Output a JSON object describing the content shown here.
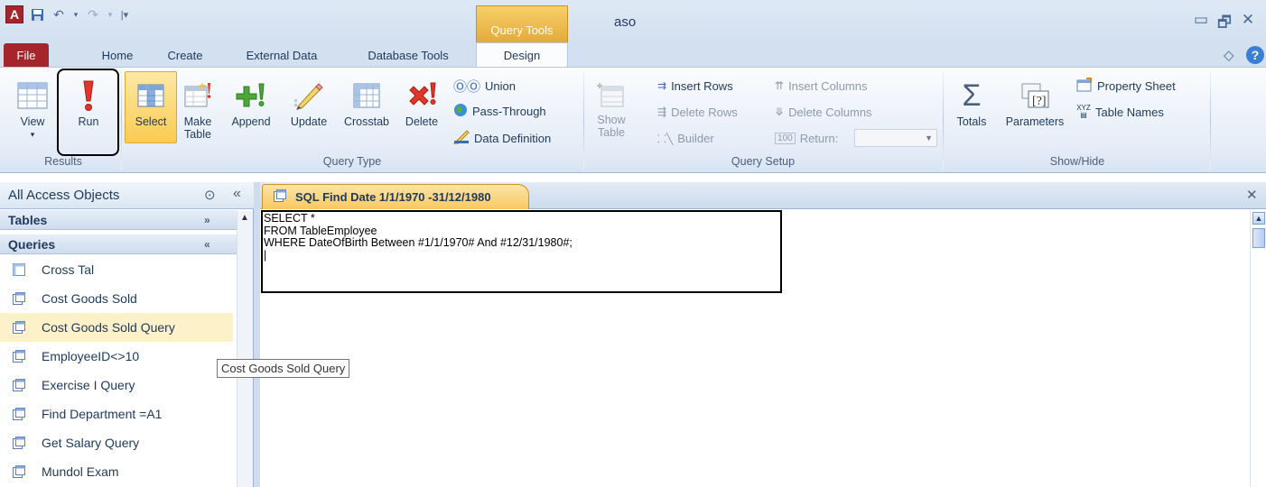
{
  "titlebar": {
    "app_logo": "A",
    "context_tab": "Query Tools",
    "doc_title": "aso",
    "win_min": "▭",
    "win_restore": "🗗",
    "win_close": "✕"
  },
  "tabs": {
    "file": "File",
    "home": "Home",
    "create": "Create",
    "external": "External Data",
    "dbtools": "Database Tools",
    "design": "Design"
  },
  "ribbon": {
    "results": {
      "label": "Results",
      "view": "View",
      "run": "Run"
    },
    "query_type": {
      "label": "Query Type",
      "select": "Select",
      "make_table_1": "Make",
      "make_table_2": "Table",
      "append": "Append",
      "update": "Update",
      "crosstab": "Crosstab",
      "delete": "Delete",
      "union": "Union",
      "pass_through": "Pass-Through",
      "data_definition": "Data Definition"
    },
    "query_setup": {
      "label": "Query Setup",
      "show_table_1": "Show",
      "show_table_2": "Table",
      "insert_rows": "Insert Rows",
      "delete_rows": "Delete Rows",
      "builder": "Builder",
      "insert_columns": "Insert Columns",
      "delete_columns": "Delete Columns",
      "return_label": "Return:",
      "return_value": ""
    },
    "show_hide": {
      "label": "Show/Hide",
      "totals": "Totals",
      "parameters": "Parameters",
      "property_sheet": "Property Sheet",
      "table_names": "Table Names"
    }
  },
  "nav": {
    "title": "All Access Objects",
    "groups": {
      "tables": "Tables",
      "queries": "Queries"
    },
    "items": [
      {
        "label": "Cross Tal"
      },
      {
        "label": "Cost Goods Sold"
      },
      {
        "label": "Cost Goods Sold Query"
      },
      {
        "label": "EmployeeID<>10"
      },
      {
        "label": "Exercise I Query"
      },
      {
        "label": "Find Department =A1"
      },
      {
        "label": "Get Salary Query"
      },
      {
        "label": "Mundol Exam"
      }
    ],
    "tooltip": "Cost Goods Sold Query"
  },
  "document": {
    "tab_title": "SQL Find Date 1/1/1970 -31/12/1980",
    "sql_text": "SELECT *\nFROM TableEmployee\nWHERE DateOfBirth Between #1/1/1970# And #12/31/1980#;\n|"
  },
  "colors": {
    "accent": "#a4262c",
    "ribbon_bg": "#dfe9f5",
    "selected": "#fbcb52",
    "context": "#e6a93b"
  }
}
